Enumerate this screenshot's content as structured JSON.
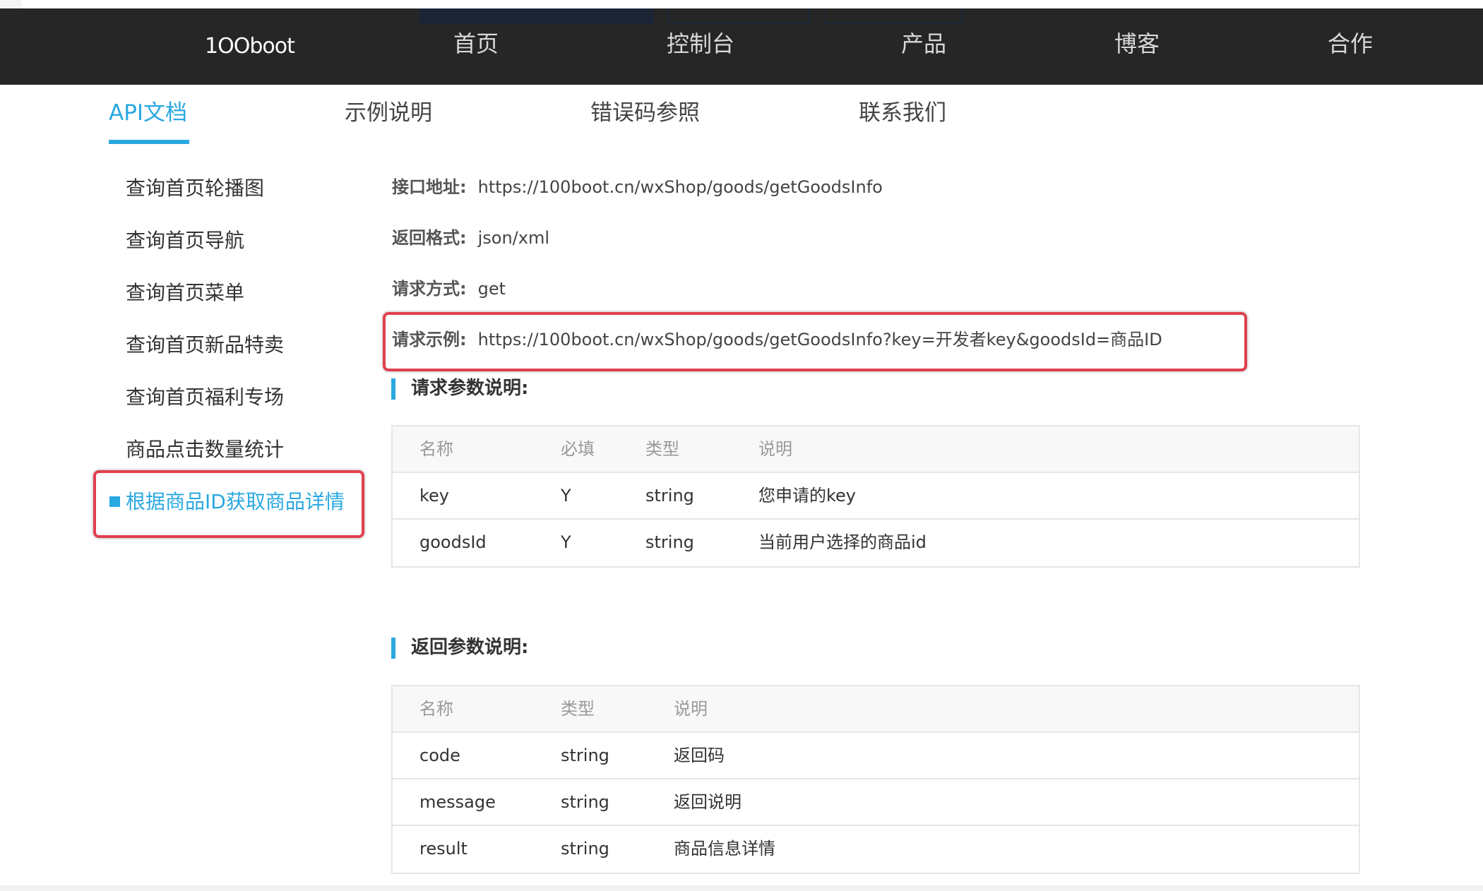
{
  "header": {
    "logo": "1OOboot",
    "nav": [
      "首页",
      "控制台",
      "产品",
      "博客",
      "合作"
    ]
  },
  "doc_tabs": [
    "API文档",
    "示例说明",
    "错误码参照",
    "联系我们"
  ],
  "sidebar": {
    "items": [
      "查询首页轮播图",
      "查询首页导航",
      "查询首页菜单",
      "查询首页新品特卖",
      "查询首页福利专场",
      "商品点击数量统计",
      "根据商品ID获取商品详情"
    ],
    "active_index": 6
  },
  "api_info": {
    "address_label": "接口地址:",
    "address": "https://100boot.cn/wxShop/goods/getGoodsInfo",
    "format_label": "返回格式:",
    "format": "json/xml",
    "method_label": "请求方式:",
    "method": "get",
    "example_label": "请求示例:",
    "example": "https://100boot.cn/wxShop/goods/getGoodsInfo?key=开发者key&goodsId=商品ID"
  },
  "request_params": {
    "title": "请求参数说明:",
    "headers": [
      "名称",
      "必填",
      "类型",
      "说明"
    ],
    "rows": [
      [
        "key",
        "Y",
        "string",
        "您申请的key"
      ],
      [
        "goodsId",
        "Y",
        "string",
        "当前用户选择的商品id"
      ]
    ]
  },
  "response_params": {
    "title": "返回参数说明:",
    "headers": [
      "名称",
      "类型",
      "说明"
    ],
    "rows": [
      [
        "code",
        "string",
        "返回码"
      ],
      [
        "message",
        "string",
        "返回说明"
      ],
      [
        "result",
        "string",
        "商品信息详情"
      ]
    ]
  },
  "colors": {
    "accent": "#29a8e0",
    "highlight": "#e1404f",
    "nav_bg": "#262626"
  }
}
